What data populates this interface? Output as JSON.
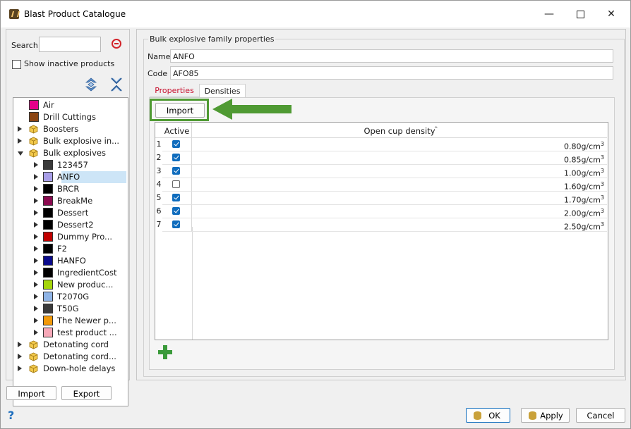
{
  "window": {
    "title": "Blast Product Catalogue"
  },
  "search": {
    "label": "Search",
    "value": "",
    "show_inactive_label": "Show inactive products",
    "show_inactive_checked": false
  },
  "tree": {
    "rows": [
      {
        "label": "Air",
        "color": "#e5008a",
        "kind": "swatch",
        "level": 1
      },
      {
        "label": "Drill Cuttings",
        "color": "#8b4513",
        "kind": "swatch",
        "level": 1
      },
      {
        "label": "Boosters",
        "kind": "folder",
        "level": 0,
        "arrow": "right"
      },
      {
        "label": "Bulk explosive in...",
        "kind": "folder",
        "level": 0,
        "arrow": "right"
      },
      {
        "label": "Bulk explosives",
        "kind": "folder",
        "level": 0,
        "arrow": "down"
      },
      {
        "label": "123457",
        "color": "#3a3a3a",
        "kind": "swatch",
        "level": 2,
        "arrow": "right"
      },
      {
        "label": "ANFO",
        "color": "#a89ee8",
        "kind": "swatch",
        "level": 2,
        "arrow": "right",
        "selected": true
      },
      {
        "label": "BRCR",
        "color": "#000000",
        "kind": "swatch",
        "level": 2,
        "arrow": "right"
      },
      {
        "label": "BreakMe",
        "color": "#8b0a50",
        "kind": "swatch",
        "level": 2,
        "arrow": "right"
      },
      {
        "label": "Dessert",
        "color": "#000000",
        "kind": "swatch",
        "level": 2,
        "arrow": "right"
      },
      {
        "label": "Dessert2",
        "color": "#000000",
        "kind": "swatch",
        "level": 2,
        "arrow": "right"
      },
      {
        "label": "Dummy Pro...",
        "color": "#c00000",
        "kind": "swatch",
        "level": 2,
        "arrow": "right"
      },
      {
        "label": "F2",
        "color": "#000000",
        "kind": "swatch",
        "level": 2,
        "arrow": "right"
      },
      {
        "label": "HANFO",
        "color": "#0a0a8c",
        "kind": "swatch",
        "level": 2,
        "arrow": "right"
      },
      {
        "label": "IngredientCost",
        "color": "#000000",
        "kind": "swatch",
        "level": 2,
        "arrow": "right"
      },
      {
        "label": "New produc...",
        "color": "#a5d60a",
        "kind": "swatch",
        "level": 2,
        "arrow": "right"
      },
      {
        "label": "T2070G",
        "color": "#8fb4e6",
        "kind": "swatch",
        "level": 2,
        "arrow": "right"
      },
      {
        "label": "T50G",
        "color": "#3a3a3a",
        "kind": "swatch",
        "level": 2,
        "arrow": "right"
      },
      {
        "label": "The Newer p...",
        "color": "#f29a0a",
        "kind": "swatch",
        "level": 2,
        "arrow": "right"
      },
      {
        "label": "test product ...",
        "color": "#f7a8b8",
        "kind": "swatch",
        "level": 2,
        "arrow": "right"
      },
      {
        "label": "Detonating cord",
        "kind": "folder",
        "level": 0,
        "arrow": "right"
      },
      {
        "label": "Detonating cord...",
        "kind": "folder",
        "level": 0,
        "arrow": "right"
      },
      {
        "label": "Down-hole delays",
        "kind": "folder",
        "level": 0,
        "arrow": "right"
      }
    ]
  },
  "left_buttons": {
    "import": "Import",
    "export": "Export"
  },
  "family": {
    "group_title": "Bulk explosive family properties",
    "name_label": "Name",
    "name_value": "ANFO",
    "code_label": "Code",
    "code_value": "AFO85"
  },
  "tabs": {
    "properties": "Properties",
    "densities": "Densities"
  },
  "densities": {
    "import_label": "Import",
    "col_active": "Active",
    "col_density": "Open cup density",
    "unit_superscript": "3",
    "rows": [
      {
        "num": "1",
        "active": true,
        "value": "0.80g/cm"
      },
      {
        "num": "2",
        "active": true,
        "value": "0.85g/cm"
      },
      {
        "num": "3",
        "active": true,
        "value": "1.00g/cm"
      },
      {
        "num": "4",
        "active": false,
        "value": "1.60g/cm"
      },
      {
        "num": "5",
        "active": true,
        "value": "1.70g/cm"
      },
      {
        "num": "6",
        "active": true,
        "value": "2.00g/cm"
      },
      {
        "num": "7",
        "active": true,
        "value": "2.50g/cm"
      }
    ]
  },
  "bottom": {
    "help": "?",
    "ok": "OK",
    "apply": "Apply",
    "cancel": "Cancel"
  },
  "colors": {
    "highlight": "#4f9a33",
    "accent": "#0f6cbd",
    "add": "#3a9a3a",
    "clear": "#d2232a",
    "active_tab_text": "#c8102e"
  }
}
